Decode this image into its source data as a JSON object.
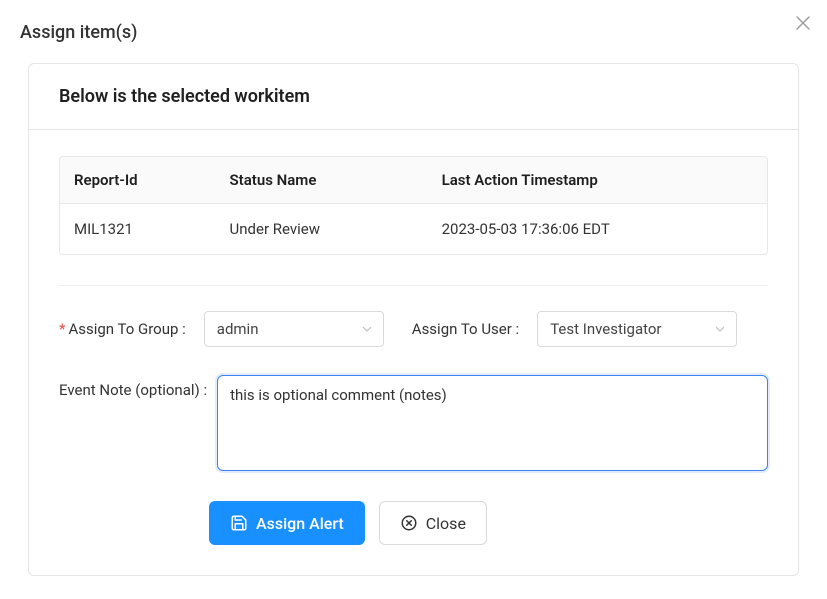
{
  "dialog": {
    "title": "Assign item(s)"
  },
  "panel": {
    "header": "Below is the selected workitem"
  },
  "table": {
    "headers": {
      "report_id": "Report-Id",
      "status_name": "Status Name",
      "last_action": "Last Action Timestamp"
    },
    "row": {
      "report_id": "MIL1321",
      "status_name": "Under Review",
      "last_action": "2023-05-03 17:36:06 EDT"
    }
  },
  "form": {
    "assign_group_label": "Assign To Group :",
    "assign_group_value": "admin",
    "assign_user_label": "Assign To User :",
    "assign_user_value": "Test Investigator",
    "event_note_label": "Event Note (optional) :",
    "event_note_value": "this is optional comment (notes)"
  },
  "buttons": {
    "assign": "Assign Alert",
    "close": "Close"
  }
}
